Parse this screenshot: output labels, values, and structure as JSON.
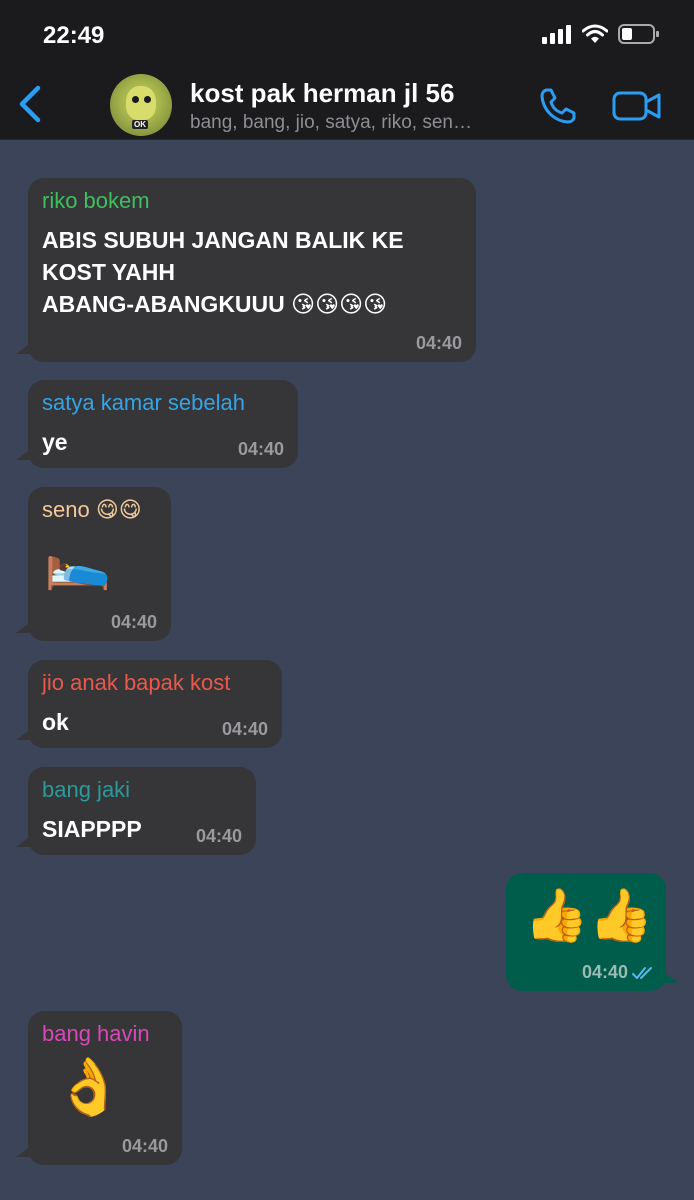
{
  "status_bar": {
    "time": "22:49"
  },
  "header": {
    "title": "kost pak herman jl 56",
    "members": "bang, bang, jio, satya, riko, sen…",
    "avatar_label": "OK"
  },
  "colors": {
    "background": "#3c4459",
    "bubble_in": "#363638",
    "bubble_out": "#005c4b",
    "accent": "#2a9df4"
  },
  "messages": [
    {
      "sender": "riko bokem",
      "sender_color": "#3fbf5f",
      "text": "ABIS SUBUH JANGAN BALIK KE\nKOST YAHH\nABANG-ABANGKUUU 😘😘😘😘",
      "time": "04:40"
    },
    {
      "sender": "satya kamar sebelah",
      "sender_color": "#35a3e6",
      "text": "ye",
      "time": "04:40"
    },
    {
      "sender": "seno 😋😋",
      "sender_color": "#f2c99b",
      "text": "🛌",
      "time": "04:40"
    },
    {
      "sender": "jio anak bapak kost",
      "sender_color": "#e8594b",
      "text": "ok",
      "time": "04:40"
    },
    {
      "sender": "bang jaki",
      "sender_color": "#2a9a9c",
      "text": "SIAPPPP",
      "time": "04:40"
    },
    {
      "sender": "",
      "outgoing": true,
      "text": "👍👍",
      "time": "04:40",
      "read": true
    },
    {
      "sender": "bang havin",
      "sender_color": "#d748b8",
      "text": "👌",
      "time": "04:40"
    }
  ]
}
